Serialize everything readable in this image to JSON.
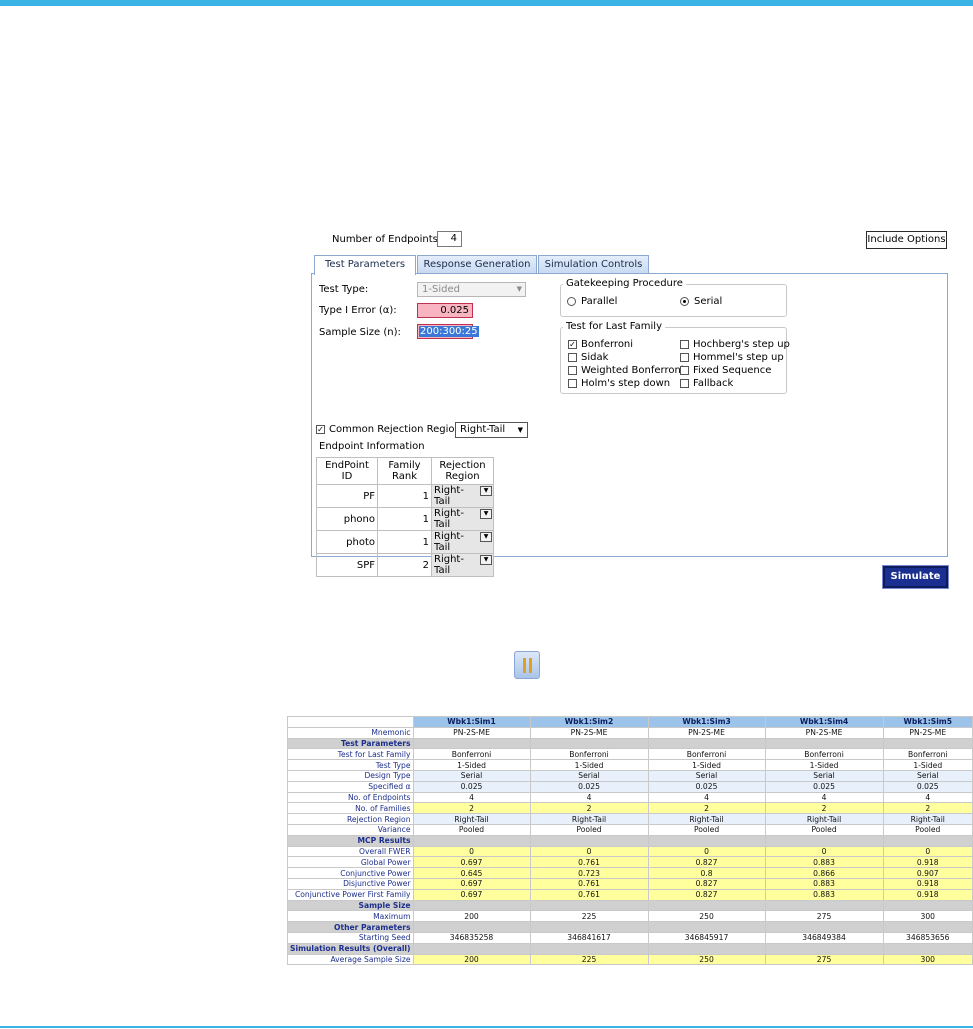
{
  "dialog": {
    "num_endpoints_label": "Number of Endpoints:",
    "num_endpoints_value": "4",
    "include_options": "Include Options",
    "tabs": [
      "Test Parameters",
      "Response Generation",
      "Simulation Controls"
    ],
    "test_type_label": "Test Type:",
    "test_type_value": "1-Sided",
    "type1_label": "Type I Error (α):",
    "type1_value": "0.025",
    "sample_size_label": "Sample Size (n):",
    "sample_size_value": "200:300:25",
    "gatekeeping_title": "Gatekeeping Procedure",
    "parallel_label": "Parallel",
    "serial_label": "Serial",
    "last_family_title": "Test for Last Family",
    "last_family_options": [
      "Bonferroni",
      "Hochberg's step up",
      "Sidak",
      "Hommel's step up",
      "Weighted Bonferroni",
      "Fixed Sequence",
      "Holm's step down",
      "Fallback"
    ],
    "common_rejection_label": "Common Rejection Region",
    "common_rejection_value": "Right-Tail",
    "endpoint_info_label": "Endpoint Information",
    "endpoint_headers": [
      "EndPoint ID",
      "Family Rank",
      "Rejection Region"
    ],
    "endpoints": [
      {
        "id": "PF",
        "rank": "1",
        "region": "Right-Tail"
      },
      {
        "id": "phono",
        "rank": "1",
        "region": "Right-Tail"
      },
      {
        "id": "photo",
        "rank": "1",
        "region": "Right-Tail"
      },
      {
        "id": "SPF",
        "rank": "2",
        "region": "Right-Tail"
      }
    ],
    "simulate": "Simulate"
  },
  "results": {
    "columns": [
      "Wbk1:Sim1",
      "Wbk1:Sim2",
      "Wbk1:Sim3",
      "Wbk1:Sim4",
      "Wbk1:Sim5"
    ],
    "rows": [
      {
        "label": "Mnemonic",
        "kind": "plain",
        "values": [
          "PN-2S-ME",
          "PN-2S-ME",
          "PN-2S-ME",
          "PN-2S-ME",
          "PN-2S-ME"
        ]
      },
      {
        "label": "Test Parameters",
        "kind": "section",
        "values": [
          "",
          "",
          "",
          "",
          ""
        ]
      },
      {
        "label": "Test for Last Family",
        "kind": "plain",
        "values": [
          "Bonferroni",
          "Bonferroni",
          "Bonferroni",
          "Bonferroni",
          "Bonferroni"
        ]
      },
      {
        "label": "Test Type",
        "kind": "plain",
        "values": [
          "1-Sided",
          "1-Sided",
          "1-Sided",
          "1-Sided",
          "1-Sided"
        ]
      },
      {
        "label": "Design Type",
        "kind": "blue",
        "values": [
          "Serial",
          "Serial",
          "Serial",
          "Serial",
          "Serial"
        ]
      },
      {
        "label": "Specified α",
        "kind": "blue",
        "values": [
          "0.025",
          "0.025",
          "0.025",
          "0.025",
          "0.025"
        ]
      },
      {
        "label": "No. of Endpoints",
        "kind": "plain",
        "values": [
          "4",
          "4",
          "4",
          "4",
          "4"
        ]
      },
      {
        "label": "No. of Families",
        "kind": "yellow",
        "values": [
          "2",
          "2",
          "2",
          "2",
          "2"
        ]
      },
      {
        "label": "Rejection Region",
        "kind": "blue",
        "values": [
          "Right-Tail",
          "Right-Tail",
          "Right-Tail",
          "Right-Tail",
          "Right-Tail"
        ]
      },
      {
        "label": "Variance",
        "kind": "plain",
        "values": [
          "Pooled",
          "Pooled",
          "Pooled",
          "Pooled",
          "Pooled"
        ]
      },
      {
        "label": "MCP Results",
        "kind": "section",
        "values": [
          "",
          "",
          "",
          "",
          ""
        ]
      },
      {
        "label": "Overall FWER",
        "kind": "yellow",
        "values": [
          "0",
          "0",
          "0",
          "0",
          "0"
        ]
      },
      {
        "label": "Global Power",
        "kind": "yellow",
        "values": [
          "0.697",
          "0.761",
          "0.827",
          "0.883",
          "0.918"
        ]
      },
      {
        "label": "Conjunctive Power",
        "kind": "yellow",
        "values": [
          "0.645",
          "0.723",
          "0.8",
          "0.866",
          "0.907"
        ]
      },
      {
        "label": "Disjunctive Power",
        "kind": "yellow",
        "values": [
          "0.697",
          "0.761",
          "0.827",
          "0.883",
          "0.918"
        ]
      },
      {
        "label": "Conjunctive Power First Family",
        "kind": "yellow",
        "values": [
          "0.697",
          "0.761",
          "0.827",
          "0.883",
          "0.918"
        ]
      },
      {
        "label": "Sample Size",
        "kind": "section",
        "values": [
          "",
          "",
          "",
          "",
          ""
        ]
      },
      {
        "label": "Maximum",
        "kind": "plain",
        "values": [
          "200",
          "225",
          "250",
          "275",
          "300"
        ]
      },
      {
        "label": "Other Parameters",
        "kind": "section",
        "values": [
          "",
          "",
          "",
          "",
          ""
        ]
      },
      {
        "label": "Starting Seed",
        "kind": "plain",
        "values": [
          "346835258",
          "346841617",
          "346845917",
          "346849384",
          "346853656"
        ]
      },
      {
        "label": "Simulation Results (Overall)",
        "kind": "section",
        "values": [
          "",
          "",
          "",
          "",
          ""
        ]
      },
      {
        "label": "Average Sample Size",
        "kind": "yellow",
        "values": [
          "200",
          "225",
          "250",
          "275",
          "300"
        ]
      }
    ]
  },
  "colors": {
    "accent_bar": "#3bb3e4",
    "simulate_button": "#1a2f8f",
    "header_cells": "#9cc3ea",
    "highlight_yellow": "#ffff9e"
  }
}
